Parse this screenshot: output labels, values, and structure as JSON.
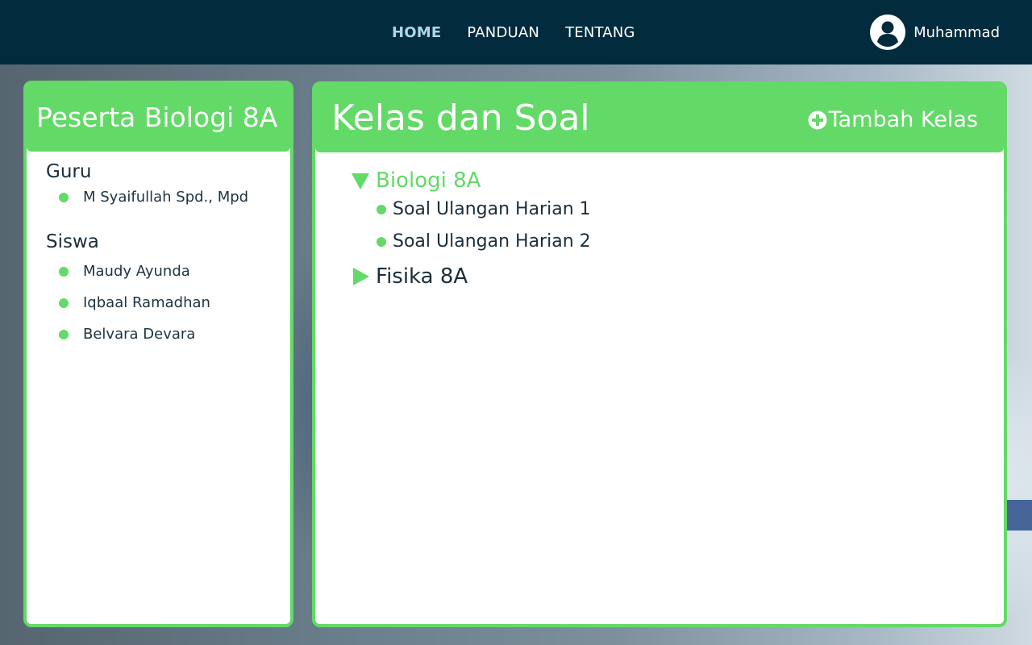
{
  "nav": {
    "links": [
      "HOME",
      "PANDUAN",
      "TENTANG"
    ],
    "active": "HOME",
    "user_name": "Muhammad",
    "user_icon": "user-circle-icon"
  },
  "left_panel": {
    "title": "Peserta Biologi 8A",
    "teacher_heading": "Guru",
    "teachers": [
      "M Syaifullah Spd., Mpd"
    ],
    "student_heading": "Siswa",
    "students": [
      "Maudy Ayunda",
      "Iqbaal Ramadhan",
      "Belvara Devara"
    ]
  },
  "right_panel": {
    "title": "Kelas dan Soal",
    "add_label": "Tambah Kelas",
    "classes": [
      {
        "name": "Biologi 8A",
        "expanded": true,
        "items": [
          "Soal Ulangan Harian 1",
          "Soal Ulangan Harian 2"
        ]
      },
      {
        "name": "Fisika 8A",
        "expanded": false,
        "items": []
      }
    ]
  },
  "colors": {
    "navbar": "#022b3d",
    "accent_green": "#63d967",
    "active_link": "#a9d8ea"
  }
}
